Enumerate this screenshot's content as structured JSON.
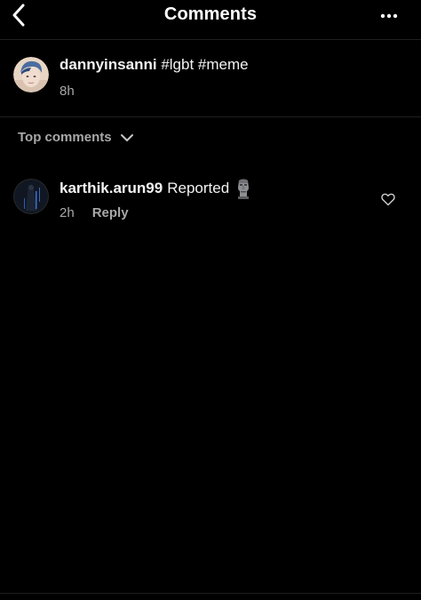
{
  "header": {
    "title": "Comments",
    "back_icon": "chevron-left-icon",
    "more_icon": "more-horizontal-icon"
  },
  "caption": {
    "username": "dannyinsanni",
    "text": "#lgbt #meme",
    "time": "8h"
  },
  "sort": {
    "label": "Top comments",
    "icon": "chevron-down-icon"
  },
  "comments": [
    {
      "username": "karthik.arun99",
      "text": "Reported",
      "emoji": "moai-emoji",
      "time": "2h",
      "reply_label": "Reply",
      "like_icon": "heart-outline-icon"
    }
  ],
  "colors": {
    "background": "#000000",
    "primary_text": "#f5f5f5",
    "secondary_text": "#a8a8a8",
    "divider": "#1f1f1f"
  }
}
